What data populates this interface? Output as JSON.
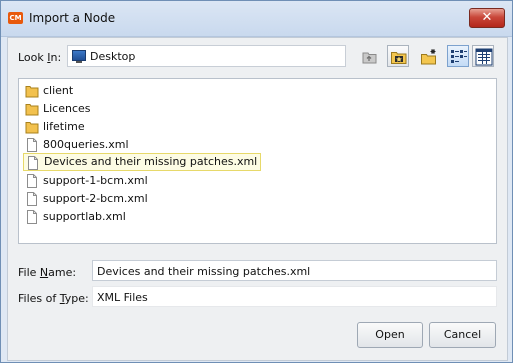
{
  "window": {
    "title": "Import a Node",
    "logo_text": "CM",
    "close_symbol": "✕"
  },
  "lookin": {
    "label": "Look In:",
    "value": "Desktop"
  },
  "files": [
    {
      "name": "client",
      "type": "folder"
    },
    {
      "name": "Licences",
      "type": "folder"
    },
    {
      "name": "lifetime",
      "type": "folder"
    },
    {
      "name": "800queries.xml",
      "type": "file"
    },
    {
      "name": "Devices and their missing patches.xml",
      "type": "file",
      "selected": true
    },
    {
      "name": "support-1-bcm.xml",
      "type": "file"
    },
    {
      "name": "support-2-bcm.xml",
      "type": "file"
    },
    {
      "name": "supportlab.xml",
      "type": "file"
    }
  ],
  "file_name": {
    "label": "File Name:",
    "value": "Devices and their missing patches.xml"
  },
  "file_type": {
    "label": "Files of Type:",
    "value": "XML Files"
  },
  "buttons": {
    "open": "Open",
    "cancel": "Cancel"
  },
  "colors": {
    "selection_fill": "#fdfce4",
    "selection_border": "#e7d96a",
    "close_button": "#c9473a",
    "folder": "#f2c14e"
  }
}
